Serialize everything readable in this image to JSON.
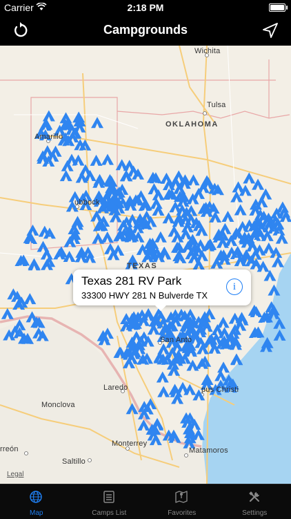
{
  "status_bar": {
    "carrier": "Carrier",
    "time": "2:18 PM",
    "battery_percent": 100
  },
  "nav": {
    "title": "Campgrounds",
    "left_icon": "refresh-icon",
    "right_icon": "location-arrow-icon"
  },
  "map": {
    "labels": {
      "wichita": "Wichita",
      "tulsa": "Tulsa",
      "oklahoma": "OKLAHOMA",
      "amarillo": "Amarillo",
      "lubbock": "ubbock",
      "texas": "TEXAS",
      "san_antonio": "San Anto",
      "corpus_christi": "pus Christi",
      "laredo": "Laredo",
      "monclova": "Monclova",
      "monterrey": "Monterrey",
      "saltillo": "Saltillo",
      "matamoros": "Matamoros",
      "torreon": "rreón"
    },
    "marker_icon": "campground-tent-icon",
    "marker_color": "#2f85f0",
    "callout": {
      "name": "Texas 281 RV Park",
      "address": "33300 HWY 281 N Bulverde TX",
      "info_icon": "info-icon"
    },
    "legal": "Legal"
  },
  "tabs": [
    {
      "label": "Map",
      "icon": "globe-icon",
      "active": true
    },
    {
      "label": "Camps List",
      "icon": "list-icon",
      "active": false
    },
    {
      "label": "Favorites",
      "icon": "map-favorites-icon",
      "active": false
    },
    {
      "label": "Settings",
      "icon": "settings-tools-icon",
      "active": false
    }
  ],
  "colors": {
    "accent": "#1f7ef0",
    "water": "#a6d4f2",
    "land": "#f3efe6"
  }
}
